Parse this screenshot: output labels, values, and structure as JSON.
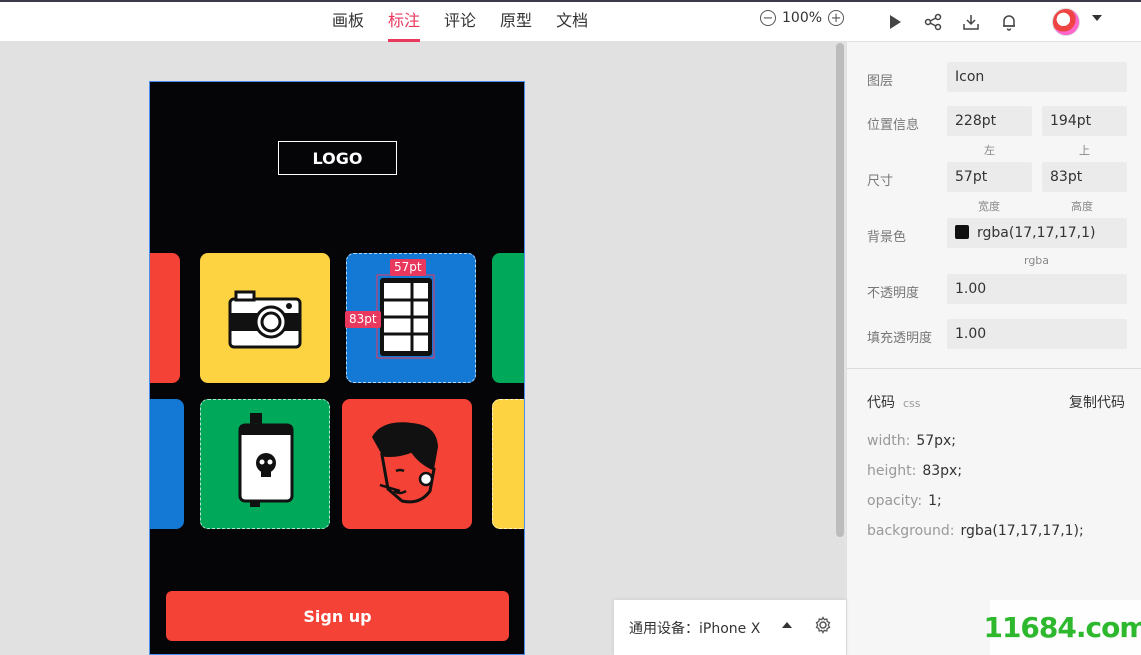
{
  "nav": {
    "tabs": [
      "画板",
      "标注",
      "评论",
      "原型",
      "文档"
    ],
    "active_tab": "标注",
    "zoom": "100%"
  },
  "artboard": {
    "logo": "LOGO",
    "signup": "Sign up",
    "measure_width": "57pt",
    "measure_height": "83pt"
  },
  "panel": {
    "layer_label": "图层",
    "layer_value": "Icon",
    "position_label": "位置信息",
    "pos_left": "228pt",
    "pos_top": "194pt",
    "pos_left_sub": "左",
    "pos_top_sub": "上",
    "size_label": "尺寸",
    "width": "57pt",
    "height": "83pt",
    "width_sub": "宽度",
    "height_sub": "高度",
    "bg_label": "背景色",
    "bg_value": "rgba(17,17,17,1)",
    "bg_sub": "rgba",
    "opacity_label": "不透明度",
    "opacity_value": "1.00",
    "fill_opacity_label": "填充透明度",
    "fill_opacity_value": "1.00",
    "code_title": "代码",
    "code_lang": "css",
    "copy_code": "复制代码",
    "code": [
      {
        "prop": "width:",
        "val": "57px;"
      },
      {
        "prop": "height:",
        "val": "83px;"
      },
      {
        "prop": "opacity:",
        "val": "1;"
      },
      {
        "prop": "background:",
        "val": "rgba(17,17,17,1);"
      }
    ]
  },
  "device": {
    "label": "通用设备：iPhone X"
  },
  "watermark": "11684.com",
  "colors": {
    "accent": "#e8385e",
    "red": "#f44336",
    "yellow": "#fdd342",
    "blue": "#1479d4",
    "green": "#00a859"
  }
}
